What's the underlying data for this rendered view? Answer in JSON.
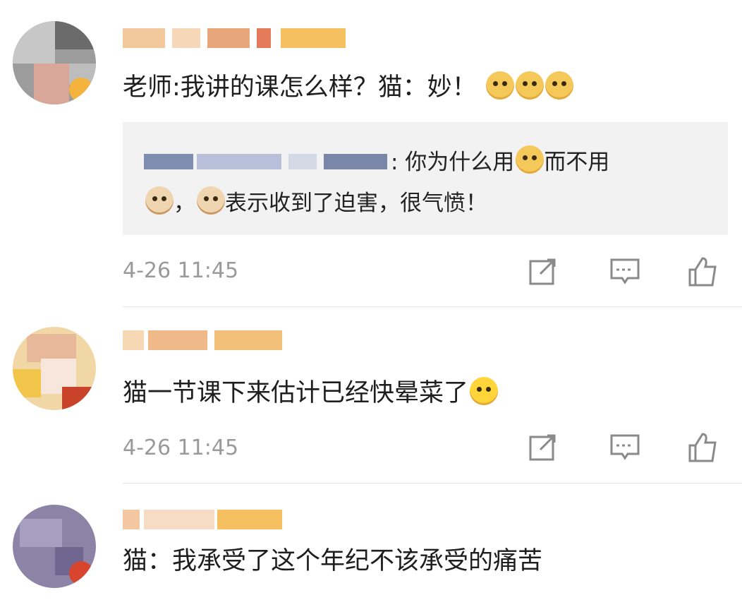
{
  "comments": [
    {
      "text": "老师:我讲的课怎么样？猫：妙！",
      "emojis": [
        "doge",
        "doge",
        "doge"
      ],
      "reply": {
        "segments": [
          ": 你为什么用",
          "而不用"
        ],
        "line2_sep": "，",
        "line2": "表示收到了迫害，很气愤！"
      },
      "time": "4-26 11:45"
    },
    {
      "text": "猫一节课下来估计已经快晕菜了",
      "emojis": [
        "laugh-cry"
      ],
      "time": "4-26 11:45"
    },
    {
      "text": "猫：我承受了这个年纪不该承受的痛苦"
    }
  ],
  "icons": {
    "repost": "repost-icon",
    "comment": "comment-icon",
    "like": "like-icon"
  }
}
